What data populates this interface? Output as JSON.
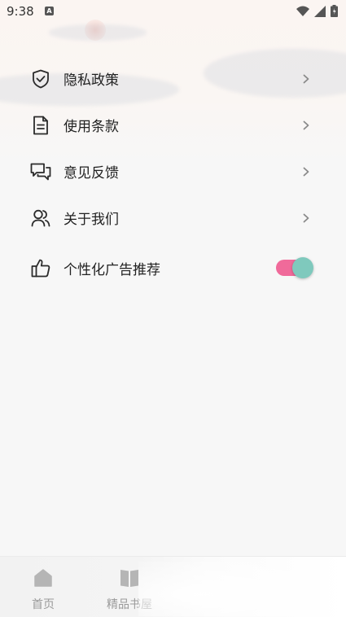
{
  "status_bar": {
    "time": "9:38",
    "notification_badge": "A",
    "icons": [
      "wifi-icon",
      "signal-icon",
      "battery-icon"
    ]
  },
  "menu": {
    "items": [
      {
        "label": "隐私政策",
        "icon": "shield-check-icon",
        "trailing": "chevron-right-icon"
      },
      {
        "label": "使用条款",
        "icon": "document-icon",
        "trailing": "chevron-right-icon"
      },
      {
        "label": "意见反馈",
        "icon": "chat-bubbles-icon",
        "trailing": "chevron-right-icon"
      },
      {
        "label": "关于我们",
        "icon": "users-icon",
        "trailing": "chevron-right-icon"
      },
      {
        "label": "个性化广告推荐",
        "icon": "thumbs-up-icon",
        "trailing": "toggle",
        "toggle_on": true
      }
    ]
  },
  "bottom_nav": {
    "items": [
      {
        "label": "首页",
        "icon": "home-icon"
      },
      {
        "label": "精品书屋",
        "icon": "book-icon"
      }
    ]
  },
  "colors": {
    "toggle_track": "#f06a9a",
    "toggle_knob": "#7fc9bd",
    "icon_stroke": "#2b2b2b",
    "chevron": "#8a8a8a",
    "nav_icon": "#b5b5b5",
    "background": "#f7f7f7"
  }
}
